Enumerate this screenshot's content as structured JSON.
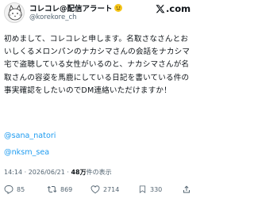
{
  "author": {
    "display_name": "コレコレ@配信アラート",
    "handle": "@korekore_ch"
  },
  "brand": {
    "logo_text": "com"
  },
  "tweet": {
    "text": "初めまして、コレコレと申します。名取さなさんとおいしくるメロンパンのナカシマさんの会話をナカシマ宅で盗聴している女性がいるのと、ナカシマさんが名取さんの容姿を馬鹿にしている日記を書いている件の事実確認をしたいのでDM連絡いただけますか！",
    "mentions": [
      "@sana_natori",
      "@nksm_sea"
    ]
  },
  "meta": {
    "time": "14:14",
    "date": "2026/06/21",
    "sep": "·",
    "views_count": "48万",
    "views_label": "件の表示"
  },
  "actions": {
    "replies": "85",
    "reposts": "869",
    "likes": "2714",
    "bookmarks": "330"
  },
  "colors": {
    "link": "#1d9bf0",
    "muted": "#536471",
    "text": "#0f1419"
  },
  "icons": [
    "x-logo-icon",
    "reply-icon",
    "repost-icon",
    "like-icon",
    "bookmark-icon",
    "share-icon",
    "cat-avatar"
  ]
}
